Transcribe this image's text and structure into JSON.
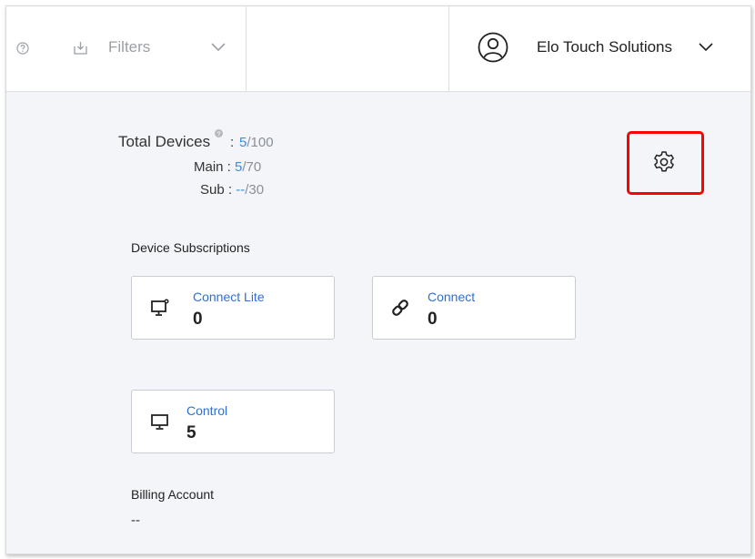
{
  "header": {
    "filters_label": "Filters",
    "org_name": "Elo Touch Solutions"
  },
  "summary": {
    "total_label": "Total Devices",
    "total_used": "5",
    "total_limit": "/100",
    "main_label": "Main :",
    "main_used": "5",
    "main_limit": "/70",
    "sub_label": "Sub :",
    "sub_used": "--",
    "sub_limit": "/30"
  },
  "subscriptions": {
    "title": "Device Subscriptions",
    "cards": [
      {
        "title": "Connect Lite",
        "count": "0",
        "icon": "monitor-gear-icon"
      },
      {
        "title": "Connect",
        "count": "0",
        "icon": "link-icon"
      },
      {
        "title": "Control",
        "count": "5",
        "icon": "monitor-icon"
      }
    ]
  },
  "billing": {
    "title": "Billing Account",
    "value": "--"
  },
  "colors": {
    "accent": "#3b8de0",
    "link": "#2e6fd6",
    "highlight": "#ff0000",
    "background": "#f4f5f8"
  }
}
